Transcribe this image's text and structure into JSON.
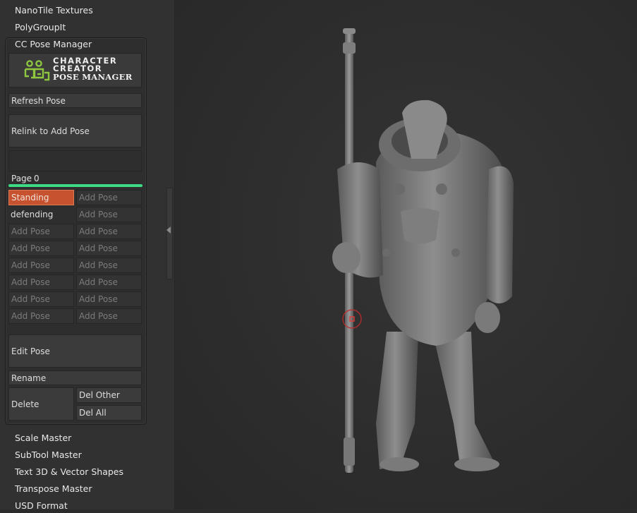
{
  "plugins_above": [
    "NanoTile Textures",
    "PolyGroupIt",
    "CC Pose Manager"
  ],
  "logo": {
    "line1": "CHARACTER",
    "line2": "CREATOR",
    "line3": "POSE MANAGER"
  },
  "pose_manager": {
    "refresh_label": "Refresh Pose",
    "relink_label": "Relink to Add Pose",
    "page_label": "Page",
    "page_value": "0",
    "page_progress": 1.0,
    "slots": [
      [
        "Standing",
        "Add Pose"
      ],
      [
        "defending",
        "Add Pose"
      ],
      [
        "Add Pose",
        "Add Pose"
      ],
      [
        "Add Pose",
        "Add Pose"
      ],
      [
        "Add Pose",
        "Add Pose"
      ],
      [
        "Add Pose",
        "Add Pose"
      ],
      [
        "Add Pose",
        "Add Pose"
      ],
      [
        "Add Pose",
        "Add Pose"
      ]
    ],
    "edit_label": "Edit Pose",
    "rename_label": "Rename",
    "delete_label": "Delete",
    "del_other_label": "Del Other",
    "del_all_label": "Del All"
  },
  "plugins_below": [
    "Scale Master",
    "SubTool Master",
    "Text 3D & Vector Shapes",
    "Transpose Master",
    "USD Format"
  ],
  "colors": {
    "accent_green": "#3ddc84",
    "active_slot": "#c6522f",
    "logo_green": "#8ec63f"
  }
}
